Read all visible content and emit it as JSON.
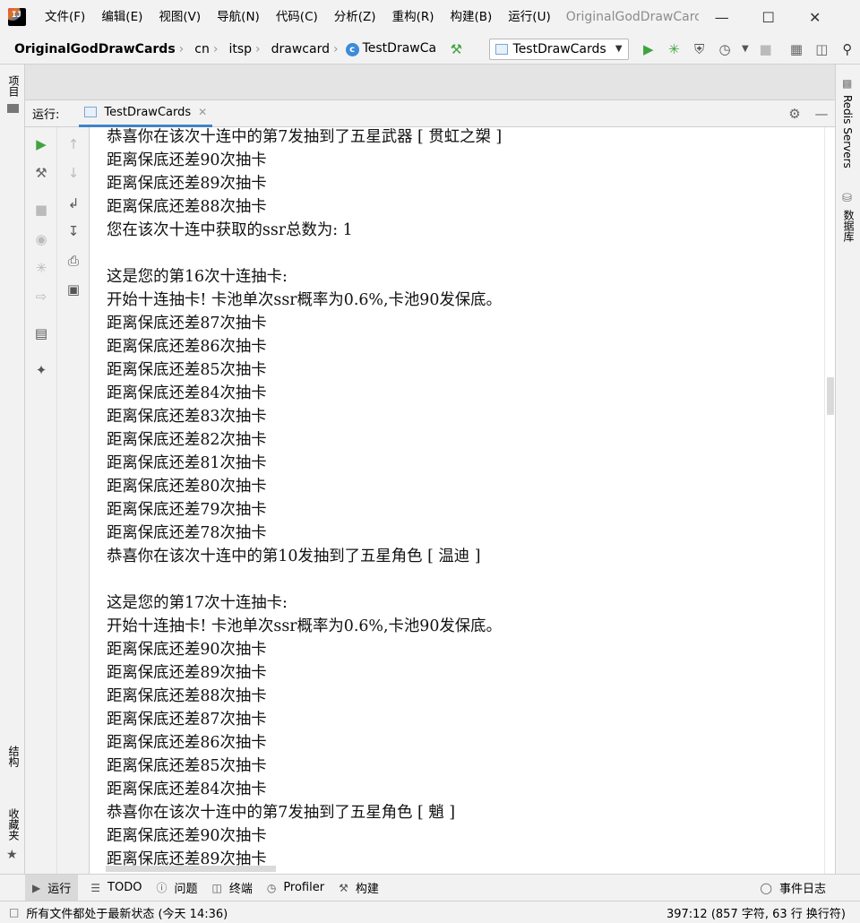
{
  "menubar": {
    "items": [
      "文件(F)",
      "编辑(E)",
      "视图(V)",
      "导航(N)",
      "代码(C)",
      "分析(Z)",
      "重构(R)",
      "构建(B)",
      "运行(U)"
    ],
    "window_title": "OriginalGodDrawCarc"
  },
  "navbar": {
    "project": "OriginalGodDrawCards",
    "crumbs": [
      "cn",
      "itsp",
      "drawcard",
      "TestDrawCa"
    ],
    "run_config": "TestDrawCards"
  },
  "left_strip": {
    "project": "项目",
    "structure": "结构",
    "favorites": "收藏夹"
  },
  "right_strip": {
    "redis": "Redis Servers",
    "database": "数据库"
  },
  "run_panel": {
    "label": "运行:",
    "tab": "TestDrawCards",
    "lines": [
      "恭喜你在该次十连中的第7发抽到了五星武器 [ 贯虹之槊 ]",
      "距离保底还差90次抽卡",
      "距离保底还差89次抽卡",
      "距离保底还差88次抽卡",
      "您在该次十连中获取的ssr总数为: 1",
      "",
      "这是您的第16次十连抽卡:",
      "开始十连抽卡! 卡池单次ssr概率为0.6%,卡池90发保底。",
      "距离保底还差87次抽卡",
      "距离保底还差86次抽卡",
      "距离保底还差85次抽卡",
      "距离保底还差84次抽卡",
      "距离保底还差83次抽卡",
      "距离保底还差82次抽卡",
      "距离保底还差81次抽卡",
      "距离保底还差80次抽卡",
      "距离保底还差79次抽卡",
      "距离保底还差78次抽卡",
      "恭喜你在该次十连中的第10发抽到了五星角色 [ 温迪 ]",
      "",
      "这是您的第17次十连抽卡:",
      "开始十连抽卡! 卡池单次ssr概率为0.6%,卡池90发保底。",
      "距离保底还差90次抽卡",
      "距离保底还差89次抽卡",
      "距离保底还差88次抽卡",
      "距离保底还差87次抽卡",
      "距离保底还差86次抽卡",
      "距离保底还差85次抽卡",
      "距离保底还差84次抽卡",
      "恭喜你在该次十连中的第7发抽到了五星角色 [ 魈 ]",
      "距离保底还差90次抽卡",
      "距离保底还差89次抽卡"
    ]
  },
  "bottom_bar": {
    "run": "运行",
    "todo": "TODO",
    "problems": "问题",
    "terminal": "终端",
    "profiler": "Profiler",
    "build": "构建",
    "event_log": "事件日志"
  },
  "status_bar": {
    "message": "所有文件都处于最新状态 (今天 14:36)",
    "position": "397:12 (857 字符, 63 行 换行符)"
  },
  "colors": {
    "run_green": "#3fa33f",
    "accent_blue": "#4083c9"
  }
}
